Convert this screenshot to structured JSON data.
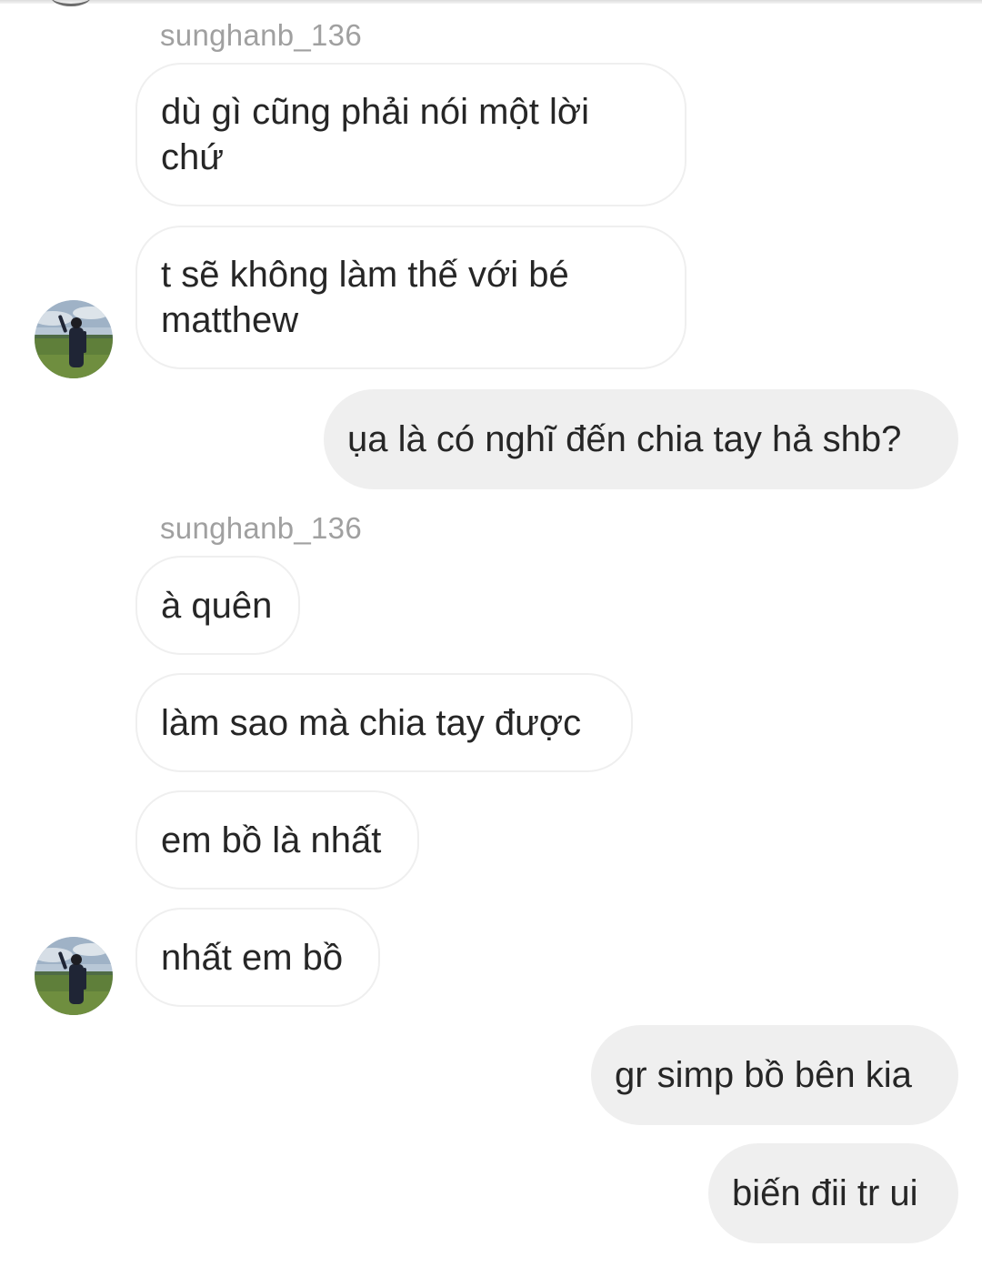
{
  "messages": [
    {
      "sender": "sunghanb_136"
    },
    {
      "text": "dù gì cũng phải nói một lời\nchứ"
    },
    {
      "text": "t sẽ không làm thế với bé\nmatthew"
    },
    {
      "text": "ụa là có nghĩ đến chia tay hả shb?"
    },
    {
      "sender": "sunghanb_136"
    },
    {
      "text": "à quên"
    },
    {
      "text": "làm sao mà chia tay được"
    },
    {
      "text": "em bồ là nhất"
    },
    {
      "text": "nhất em bồ"
    },
    {
      "text": "gr simp bồ bên kia"
    },
    {
      "text": "biến đii tr ui"
    }
  ],
  "colors": {
    "incoming_bubble": "#ffffff",
    "incoming_border": "#efefef",
    "outgoing_bubble": "#efefef",
    "text": "#262626",
    "sender_label": "#a0a0a0"
  },
  "icons": [
    "avatar-photo"
  ]
}
